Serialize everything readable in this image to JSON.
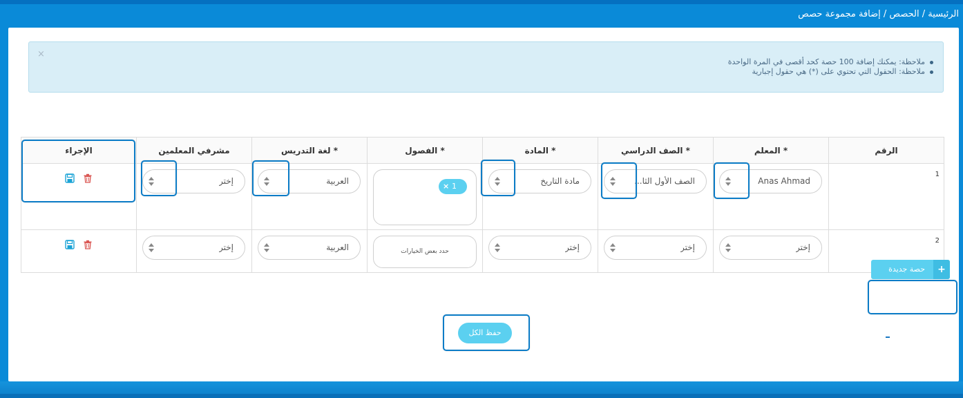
{
  "breadcrumb": "الرئيسية / الحصص / إضافة مجموعة حصص",
  "alert": {
    "notes": [
      "ملاحظة: يمكنك إضافة 100 حصة كحد أقصى في المرة الواحدة",
      "ملاحظة: الحقول التي تحتوي على (*) هي حقول إجبارية"
    ],
    "close": "×"
  },
  "table": {
    "headers": {
      "number": "الرقم",
      "teacher": "* المعلم",
      "grade": "* الصف الدراسي",
      "subject": "* المادة",
      "classes": "* الفصول",
      "language": "* لغة التدريس",
      "supervisors": "مشرفي المعلمين",
      "action": "الإجراء"
    },
    "rows": [
      {
        "number": "1",
        "teacher": "Anas Ahmad",
        "grade": "الصف الأول الثا...",
        "subject": "مادة التاريخ",
        "classes_chip": "1",
        "chip_remove": "×",
        "language": "العربية",
        "supervisors": "إختر"
      },
      {
        "number": "2",
        "teacher": "إختر",
        "grade": "إختر",
        "subject": "إختر",
        "classes_placeholder": "حدد بعض الخيارات",
        "language": "العربية",
        "supervisors": "إختر"
      }
    ]
  },
  "buttons": {
    "new_lesson": "حصة جديدة",
    "new_lesson_icon": "+",
    "save_all": "حفظ الكل"
  },
  "icons": {
    "save": "save-icon",
    "delete": "trash-icon"
  },
  "colors": {
    "primary": "#0a8ad8",
    "accent": "#5bd0f0",
    "save_icon": "#1aa3d6",
    "delete_icon": "#d9534f"
  }
}
